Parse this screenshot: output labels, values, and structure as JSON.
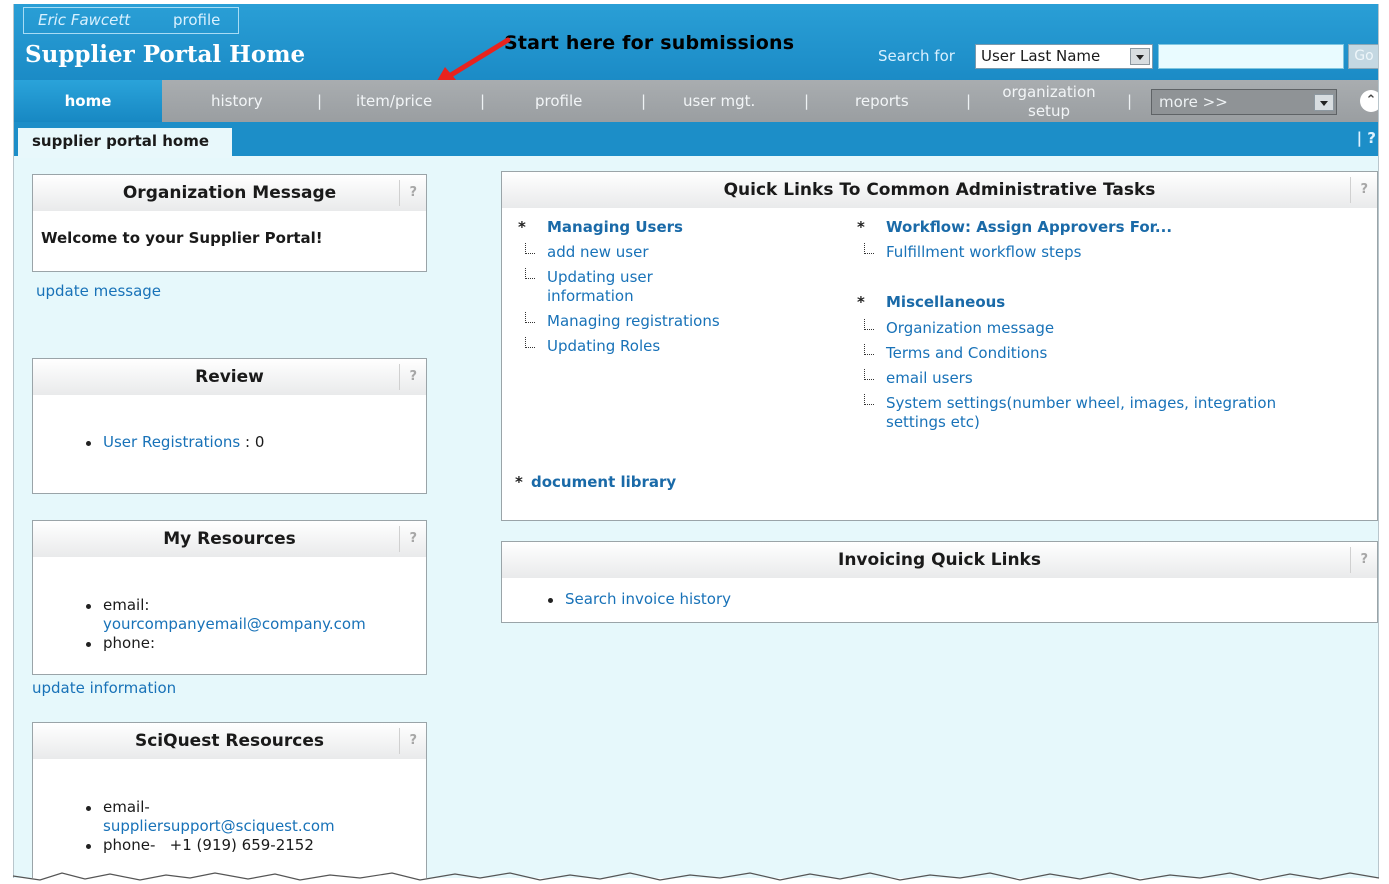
{
  "header": {
    "user_name": "Eric Fawcett",
    "user_profile_link": "profile",
    "app_title": "Supplier Portal Home",
    "annotation": "Start here for submissions",
    "search_label": "Search for",
    "search_select_value": "User Last Name",
    "search_input_value": "",
    "go_label": "Go"
  },
  "nav": {
    "items": [
      {
        "label": "home"
      },
      {
        "label": "history"
      },
      {
        "label": "item/price"
      },
      {
        "label": "profile"
      },
      {
        "label": "user mgt."
      },
      {
        "label": "reports"
      },
      {
        "label": "organization setup"
      }
    ],
    "separator": "|",
    "more_value": "more >>",
    "collapse_icon": "double-chevron-up"
  },
  "subbar": {
    "active_tab": "supplier portal home",
    "help": "?"
  },
  "left": {
    "org_message": {
      "title": "Organization Message",
      "body": "Welcome to your Supplier Portal!",
      "link": "update message"
    },
    "review": {
      "title": "Review",
      "item_label": "User Registrations",
      "item_sep": ":",
      "item_count": "0"
    },
    "my_resources": {
      "title": "My Resources",
      "email_label": "email:",
      "email_value": "yourcompanyemail@company.com",
      "phone_label": "phone:",
      "link": "update information"
    },
    "sciquest": {
      "title": "SciQuest Resources",
      "email_label": "email-",
      "email_value": "suppliersupport@sciquest.com",
      "phone_label": "phone-",
      "phone_value": "+1 (919) 659-2152"
    },
    "help": "?"
  },
  "quick_links": {
    "title": "Quick Links To Common Administrative Tasks",
    "star": "*",
    "managing_users": {
      "heading": "Managing Users",
      "items": [
        "add new user",
        "Updating user",
        "information",
        "Managing registrations",
        "Updating Roles"
      ]
    },
    "workflow": {
      "heading": "Workflow: Assign Approvers For...",
      "items": [
        "Fulfillment workflow steps"
      ]
    },
    "misc": {
      "heading": "Miscellaneous",
      "items": [
        "Organization message",
        "Terms and Conditions",
        "email users",
        "System settings(number wheel, images, integration",
        "settings etc)"
      ]
    },
    "document_library": "document library"
  },
  "invoicing": {
    "title": "Invoicing Quick Links",
    "item": "Search invoice history"
  },
  "colors": {
    "header_blue": "#1b8bc6",
    "nav_gray": "#a9adb0",
    "page_bg": "#e6f8fb",
    "link_blue": "#1872b8",
    "annotation_arrow": "#e8231e"
  }
}
